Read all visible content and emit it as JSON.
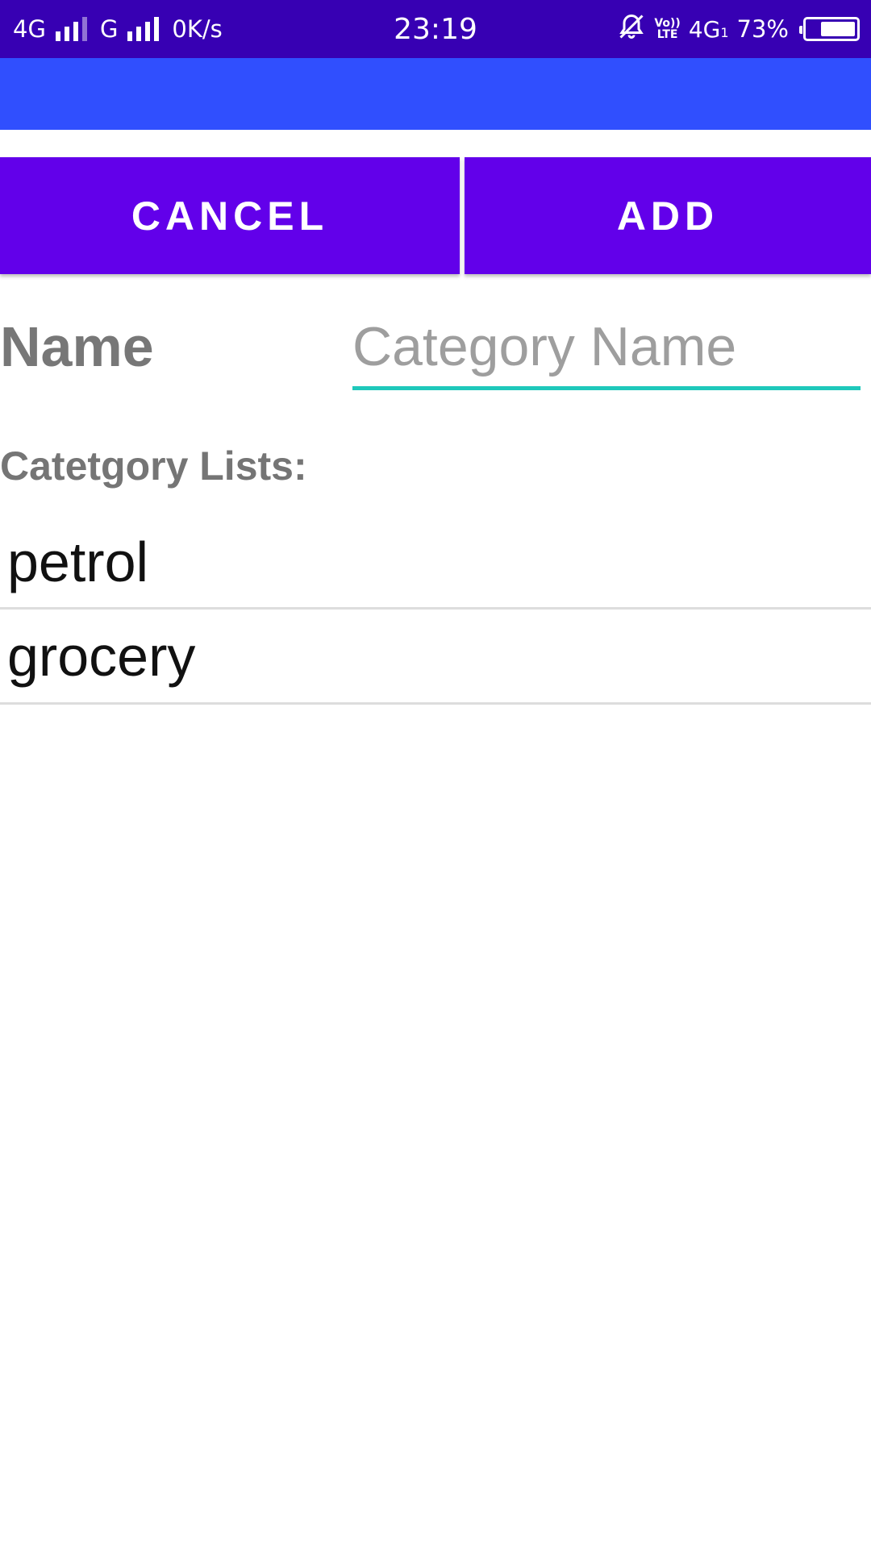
{
  "status_bar": {
    "network_1": "4G",
    "network_2": "G",
    "speed": "0K/s",
    "time": "23:19",
    "volte_top": "Vo))",
    "volte_bottom": "LTE",
    "network_3": "4G",
    "sim_index": "1",
    "battery_percent": "73%",
    "battery_level": 0.73,
    "icons": [
      "signal-icon",
      "signal-icon",
      "alarm-off-icon",
      "volte-icon",
      "data-4g-icon",
      "battery-icon"
    ]
  },
  "app_bar": {
    "color": "#304ffe"
  },
  "buttons": {
    "cancel_label": "CANCEL",
    "add_label": "ADD",
    "color": "#6200ea"
  },
  "form": {
    "name_label": "Name",
    "name_placeholder": "Category Name",
    "name_value": "",
    "underline_color": "#1fc8bb"
  },
  "lists": {
    "title": "Catetgory Lists:",
    "items": [
      {
        "label": "petrol"
      },
      {
        "label": "grocery"
      }
    ]
  }
}
